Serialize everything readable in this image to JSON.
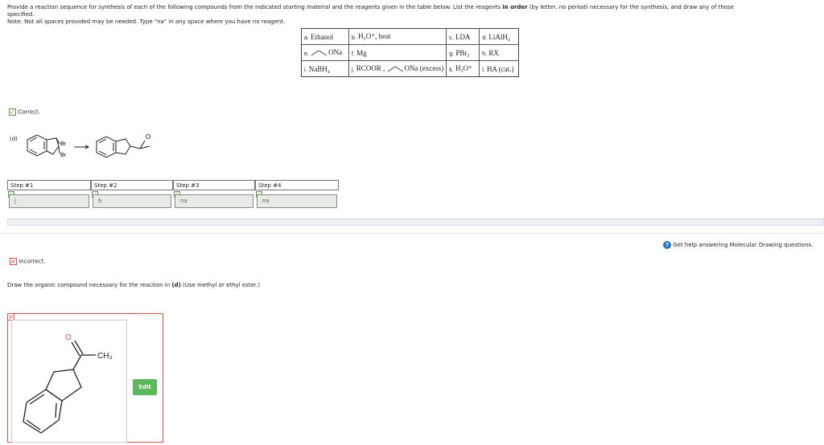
{
  "intro": {
    "line1": "Provide a reaction sequence for synthesis of each of the following compounds from the indicated starting material and the reagents given in the table below. List the reagents",
    "line1_bold": "in order",
    "line1_tail": "(by letter, no period) necessary for the synthesis, and draw any of those",
    "line2": "specified.",
    "note": "Note: Not all spaces provided may be needed. Type \"na\" in any space where you have no reagent."
  },
  "reagents": {
    "a": {
      "letter": "a.",
      "text": "Ethanol"
    },
    "b": {
      "letter": "b.",
      "text": "H₃O⁺, heat"
    },
    "c": {
      "letter": "c.",
      "text": "LDA"
    },
    "d": {
      "letter": "d.",
      "text": "LiAlH₄"
    },
    "e": {
      "letter": "e.",
      "text": "ONa"
    },
    "f": {
      "letter": "f.",
      "text": "Mg"
    },
    "g": {
      "letter": "g.",
      "text": "PBr₃"
    },
    "h": {
      "letter": "h.",
      "text": "RX"
    },
    "i": {
      "letter": "i.",
      "text": "NaBH₄"
    },
    "j": {
      "letter": "j.",
      "text": "RCOOR ,",
      "text2": "ONa (excess)"
    },
    "k": {
      "letter": "k.",
      "text": "H₃O⁺"
    },
    "l": {
      "letter": "l.",
      "text": "HA (cat.)"
    }
  },
  "status1": {
    "label": "Correct.",
    "color": "#5a9e3a"
  },
  "reaction": {
    "label": "(d)",
    "br1": "Br",
    "br2": "Br",
    "carbonyl_o": "O"
  },
  "steps": [
    {
      "header": "Step #1",
      "value": "j"
    },
    {
      "header": "Step #2",
      "value": "b"
    },
    {
      "header": "Step #3",
      "value": "na"
    },
    {
      "header": "Step #4",
      "value": "na"
    }
  ],
  "help": {
    "text": "Get help answering Molecular Drawing questions.",
    "icon": "question-icon",
    "color": "#2a74c9"
  },
  "status2": {
    "label": "Incorrect.",
    "color": "#d9534f"
  },
  "prompt": {
    "text": "Draw the organic compound necessary for the reaction in",
    "bold": "(d)",
    "tail": "(Use methyl or ethyl ester.)"
  },
  "drawing": {
    "o_label": "O",
    "ch3_label": "CH₃",
    "edit_label": "Edit"
  }
}
